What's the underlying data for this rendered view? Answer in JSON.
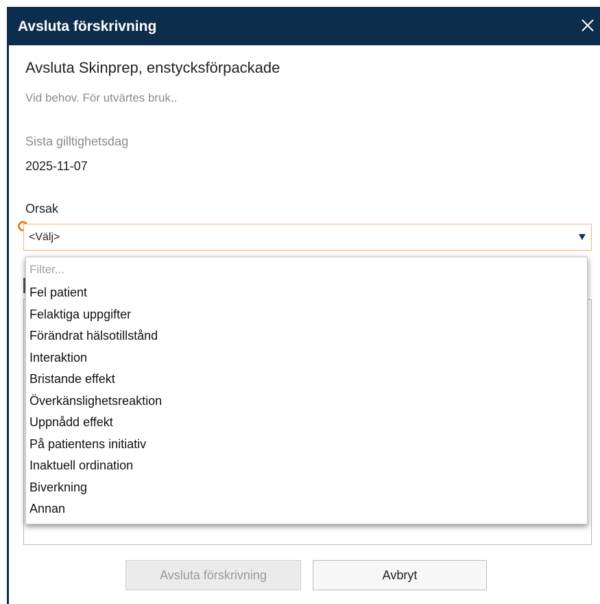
{
  "dialog": {
    "title": "Avsluta förskrivning",
    "close_icon": "close-icon"
  },
  "prescription": {
    "heading": "Avsluta Skinprep, enstycksförpackade",
    "dosage": "Vid behov. För utvärtes bruk..",
    "valid_label": "Sista gilltighetsdag",
    "valid_value": "2025-11-07"
  },
  "reason": {
    "label": "Orsak",
    "selected": "<Välj>",
    "filter_placeholder": "Filter...",
    "options": [
      "Fel patient",
      "Felaktiga uppgifter",
      "Förändrat hälsotillstånd",
      "Interaktion",
      "Bristande effekt",
      "Överkänslighetsreaktion",
      "Uppnådd effekt",
      "På patientens initiativ",
      "Inaktuell ordination",
      "Biverkning",
      "Annan"
    ]
  },
  "buttons": {
    "confirm_label": "Avsluta förskrivning",
    "cancel_label": "Avbryt"
  },
  "colors": {
    "title_bar": "#0d2d4d",
    "required_marker": "#f07d1e"
  }
}
